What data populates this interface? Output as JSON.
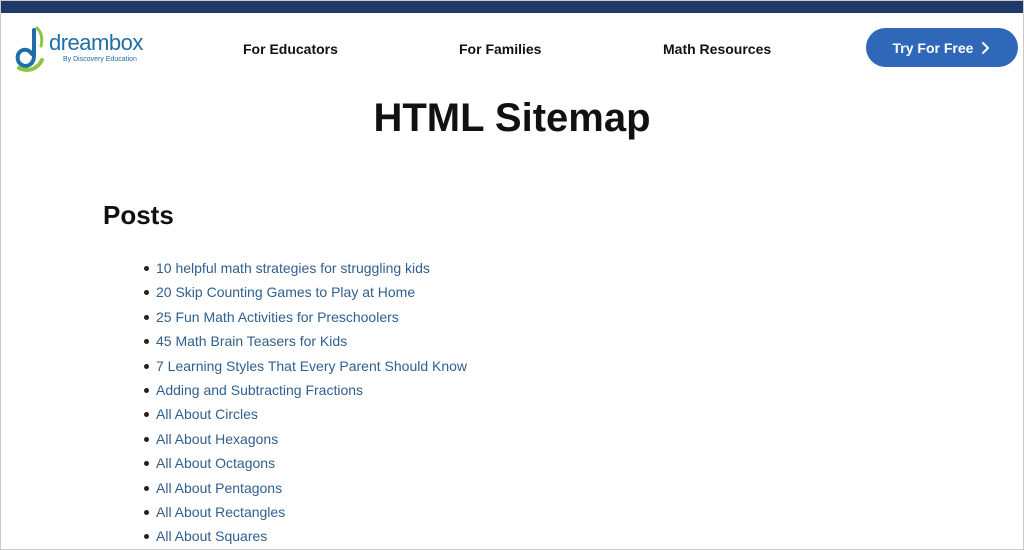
{
  "brand": {
    "name": "dreambox",
    "subtitle": "By Discovery Education",
    "primary_color": "#1e6fa8",
    "accent_color": "#8cc63f",
    "top_bar_color": "#1f3a68"
  },
  "nav": {
    "items": [
      {
        "label": "For Educators"
      },
      {
        "label": "For Families"
      },
      {
        "label": "Math Resources"
      }
    ],
    "cta": {
      "label": "Try For Free",
      "icon": "chevron-right-icon",
      "color": "#2f68b8"
    }
  },
  "page": {
    "title": "HTML Sitemap",
    "section_title": "Posts",
    "link_color": "#2f5f8f"
  },
  "posts": [
    "10 helpful math strategies for struggling kids",
    "20 Skip Counting Games to Play at Home",
    "25 Fun Math Activities for Preschoolers",
    "45 Math Brain Teasers for Kids",
    "7 Learning Styles That Every Parent Should Know",
    "Adding and Subtracting Fractions",
    "All About Circles",
    "All About Hexagons",
    "All About Octagons",
    "All About Pentagons",
    "All About Rectangles",
    "All About Squares"
  ]
}
